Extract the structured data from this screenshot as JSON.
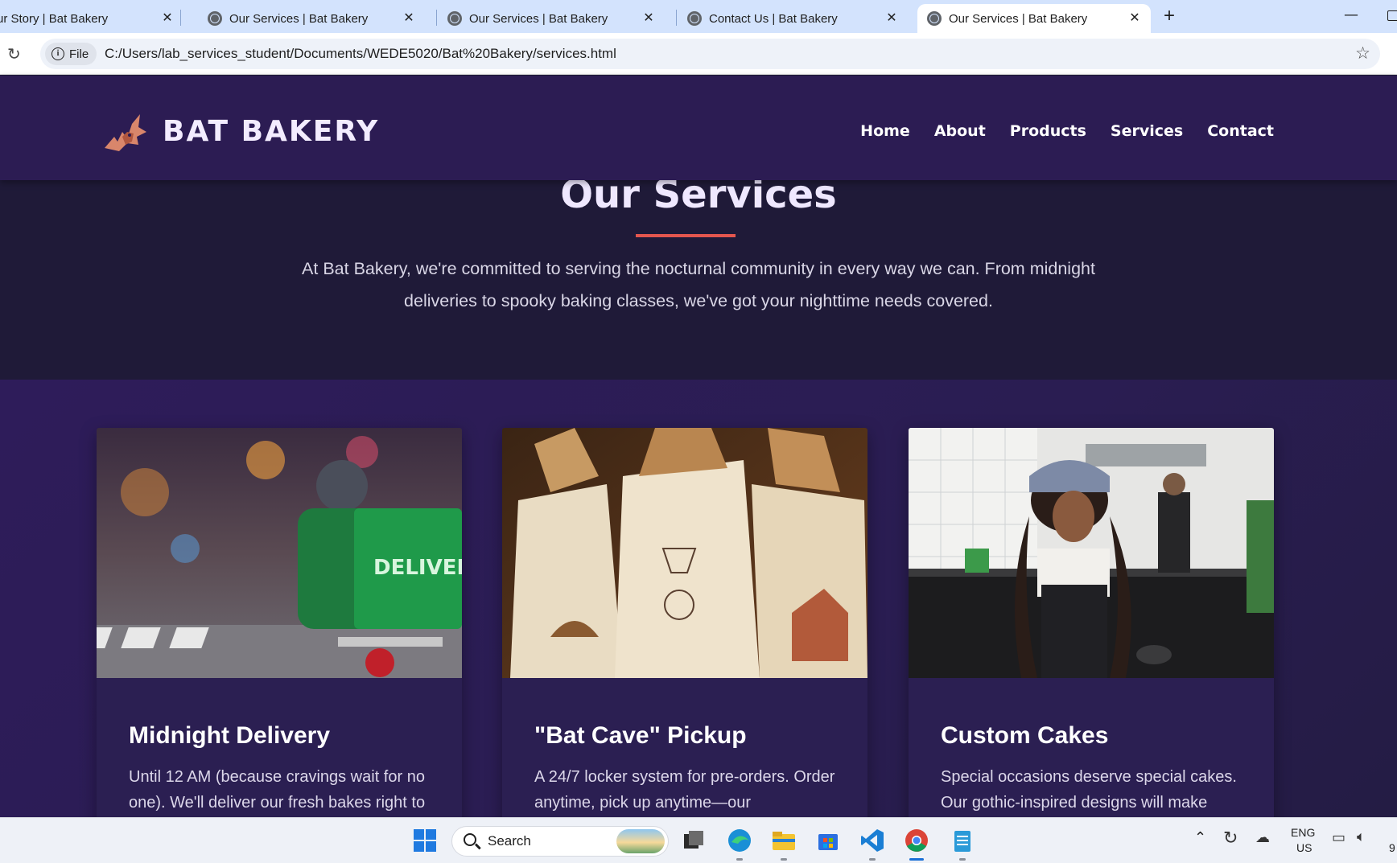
{
  "browser": {
    "tabs": [
      {
        "title": "ur Story | Bat Bakery",
        "active": false
      },
      {
        "title": "Our Services | Bat Bakery",
        "active": false
      },
      {
        "title": "Our Services | Bat Bakery",
        "active": false
      },
      {
        "title": "Contact Us | Bat Bakery",
        "active": false
      },
      {
        "title": "Our Services | Bat Bakery",
        "active": true
      }
    ],
    "close_glyph": "✕",
    "new_tab_glyph": "+",
    "file_chip_label": "File",
    "url": "C:/Users/lab_services_student/Documents/WEDE5020/Bat%20Bakery/services.html"
  },
  "site": {
    "brand": "BAT BAKERY",
    "nav": [
      "Home",
      "About",
      "Products",
      "Services",
      "Contact"
    ]
  },
  "hero": {
    "title": "Our Services",
    "text": "At Bat Bakery, we're committed to serving the nocturnal community in every way we can. From midnight deliveries to spooky baking classes, we've got your nighttime needs covered."
  },
  "services": [
    {
      "title": "Midnight Delivery",
      "text": "Until 12 AM (because cravings wait for no one). We'll deliver our fresh bakes right to",
      "image_caption": "DELIVERY"
    },
    {
      "title": "\"Bat Cave\" Pickup",
      "text": "A 24/7 locker system for pre-orders. Order anytime, pick up anytime—our"
    },
    {
      "title": "Custom Cakes",
      "text": "Special occasions deserve special cakes. Our gothic-inspired designs will make"
    }
  ],
  "taskbar": {
    "search_label": "Search",
    "lang_top": "ENG",
    "lang_bottom": "US",
    "clock_fragment": "9"
  },
  "colors": {
    "header_bg": "#2c1c53",
    "hero_bg": "#1f1a38",
    "accent_underline": "#e4564e",
    "tabbar_bg": "#d3e3fd"
  }
}
